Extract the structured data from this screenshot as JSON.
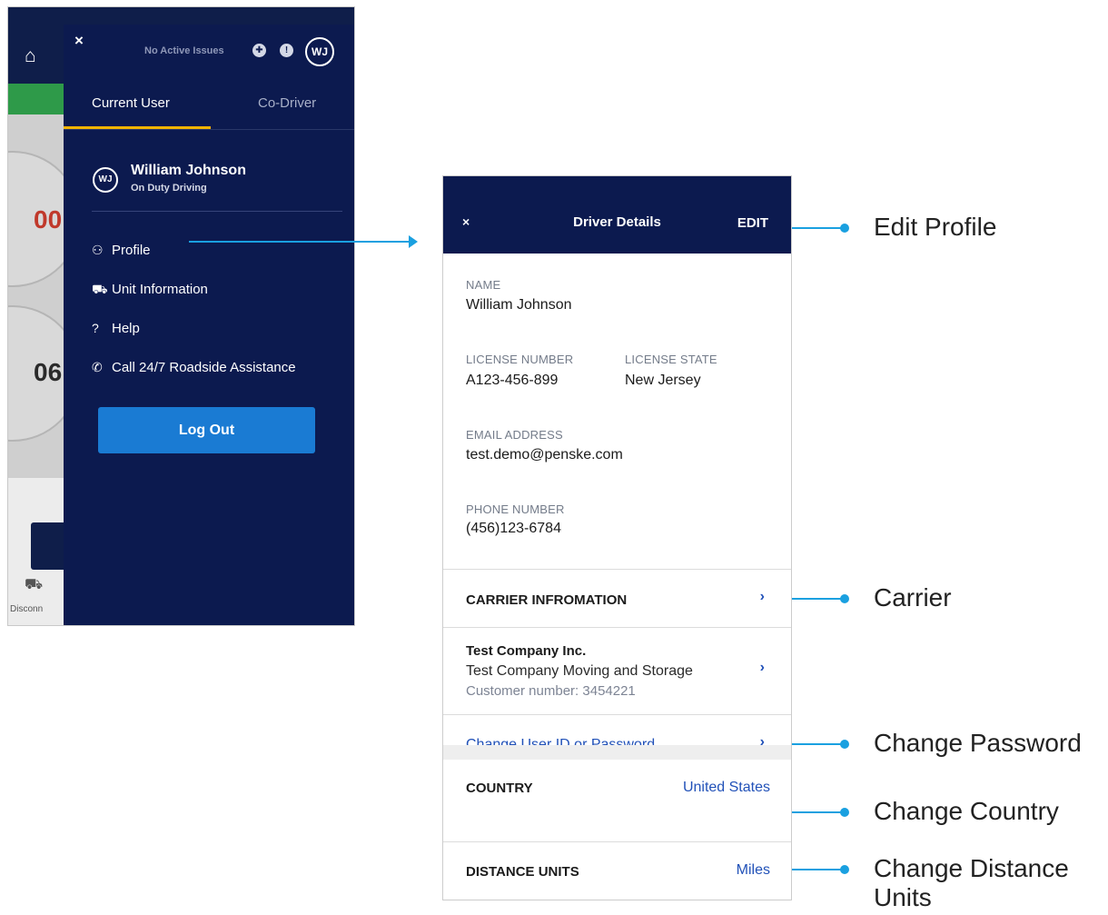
{
  "drawer": {
    "close_glyph": "×",
    "status_text": "No Active Issues",
    "avatar_initials": "WJ",
    "tabs": [
      {
        "label": "Current User"
      },
      {
        "label": "Co-Driver"
      }
    ],
    "user": {
      "initials": "WJ",
      "name": "William Johnson",
      "status": "On Duty Driving"
    },
    "menu": [
      {
        "label": "Profile",
        "icon": "user-icon"
      },
      {
        "label": "Unit Information",
        "icon": "truck-icon"
      },
      {
        "label": "Help",
        "icon": "help-circle-icon"
      },
      {
        "label": "Call 24/7 Roadside Assistance",
        "icon": "phone-icon"
      }
    ],
    "logout_label": "Log Out"
  },
  "background": {
    "num_1": "00",
    "num_2": "06",
    "bottom_label": "Disconn"
  },
  "details": {
    "close_glyph": "×",
    "title": "Driver Details",
    "edit_label": "EDIT",
    "fields": {
      "name_label": "NAME",
      "name_value": "William Johnson",
      "license_number_label": "LICENSE NUMBER",
      "license_number_value": "A123-456-899",
      "license_state_label": "LICENSE STATE",
      "license_state_value": "New Jersey",
      "email_label": "EMAIL ADDRESS",
      "email_value": "test.demo@penske.com",
      "phone_label": "PHONE NUMBER",
      "phone_value": "(456)123-6784"
    },
    "carrier_title": "CARRIER INFROMATION",
    "company": {
      "name": "Test Company Inc.",
      "full_name": "Test Company Moving and Storage",
      "customer_number": "Customer number: 3454221"
    },
    "change_credentials_label": "Change User ID or Password",
    "country_label": "COUNTRY",
    "country_value": "United States",
    "distance_units_label": "DISTANCE UNITS",
    "distance_units_value": "Miles",
    "chevron_glyph": "›"
  },
  "callouts": [
    {
      "label": "Edit Profile"
    },
    {
      "label": "Carrier"
    },
    {
      "label": "Change Password"
    },
    {
      "label": "Change Country"
    },
    {
      "label": "Change Distance Units"
    }
  ],
  "colors": {
    "navy": "#0c1a4f",
    "accent_blue": "#1a7bd3",
    "link_blue": "#2151b8",
    "callout_blue": "#1aa0e0",
    "tab_underline": "#f4b400"
  }
}
